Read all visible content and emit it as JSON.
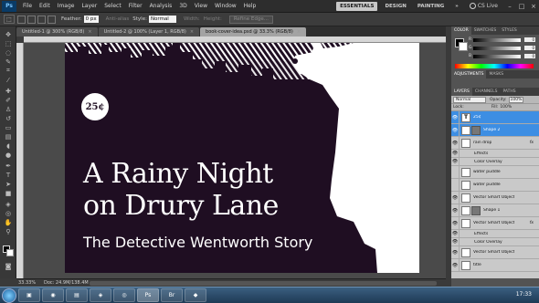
{
  "menubar": {
    "app_badge": "Ps",
    "items": [
      "File",
      "Edit",
      "Image",
      "Layer",
      "Select",
      "Filter",
      "Analysis",
      "3D",
      "View",
      "Window",
      "Help"
    ],
    "workspaces": [
      "ESSENTIALS",
      "DESIGN",
      "PAINTING"
    ],
    "more": "»",
    "cs_live": "CS Live"
  },
  "options": {
    "feather_label": "Feather:",
    "feather_value": "0 px",
    "antialias_label": "Anti-alias",
    "style_label": "Style:",
    "style_value": "Normal",
    "width_label": "Width:",
    "height_label": "Height:",
    "refine_edge": "Refine Edge..."
  },
  "tabs": [
    {
      "label": "Untitled-1 @ 300% (RGB/8)",
      "close": "×"
    },
    {
      "label": "Untitled-2 @ 100% (Layer 1, RGB/8)",
      "close": "×"
    },
    {
      "label": "book-cover-idea.psd @ 33.3% (RGB/8)",
      "close": "×"
    }
  ],
  "document": {
    "price": "25¢",
    "title_line1": "A Rainy Night",
    "title_line2": "on Drury Lane",
    "subtitle": "The Detective Wentworth Story",
    "colors": {
      "background": "#1f0e22",
      "foreground": "#ffffff"
    }
  },
  "status": {
    "zoom": "33.33%",
    "doc": "Doc: 24.9M/138.4M"
  },
  "panels": {
    "color_tabs": [
      "COLOR",
      "SWATCHES",
      "STYLES"
    ],
    "color_sliders": [
      {
        "label": "R",
        "value": "0"
      },
      {
        "label": "G",
        "value": "0"
      },
      {
        "label": "B",
        "value": "0"
      }
    ],
    "adj_tabs": [
      "ADJUSTMENTS",
      "MASKS"
    ],
    "layers_tabs": [
      "LAYERS",
      "CHANNELS",
      "PATHS"
    ],
    "blend_mode": "Normal",
    "opacity_label": "Opacity:",
    "opacity_value": "100%",
    "lock_label": "Lock:",
    "fill_label": "Fill:",
    "fill_value": "100%",
    "layers": [
      {
        "name": "25¢",
        "type": "text",
        "thumb": "T",
        "selected": true
      },
      {
        "name": "Shape 2",
        "type": "shape",
        "selected": true,
        "secondary": true
      },
      {
        "name": "rain drop",
        "type": "smart",
        "fx": "fx"
      },
      {
        "name": "Effects",
        "type": "sub"
      },
      {
        "name": "Color Overlay",
        "type": "sub"
      },
      {
        "name": "water puddle",
        "type": "smart"
      },
      {
        "name": "water puddle",
        "type": "smart"
      },
      {
        "name": "Vector Smart Object",
        "type": "smart"
      },
      {
        "name": "Shape 1",
        "type": "shape"
      },
      {
        "name": "Vector Smart Object",
        "type": "smart",
        "fx": "fx"
      },
      {
        "name": "Effects",
        "type": "sub"
      },
      {
        "name": "Color Overlay",
        "type": "sub"
      },
      {
        "name": "Vector Smart Object",
        "type": "smart"
      },
      {
        "name": "title",
        "type": "smart"
      }
    ]
  },
  "taskbar": {
    "time": "17:33"
  }
}
